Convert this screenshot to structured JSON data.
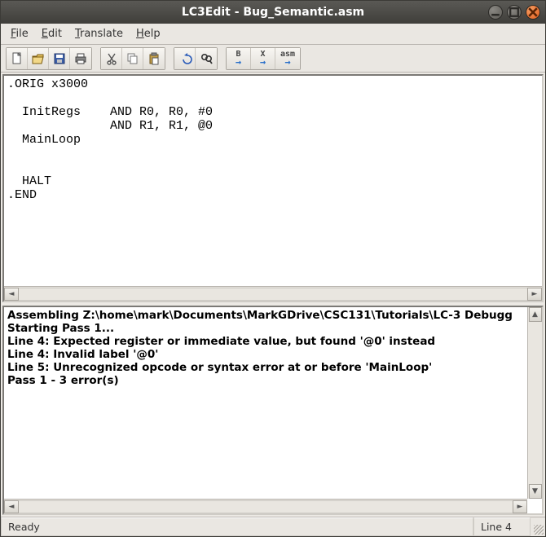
{
  "window": {
    "title": "LC3Edit - Bug_Semantic.asm"
  },
  "menu": {
    "file": "File",
    "edit": "Edit",
    "translate": "Translate",
    "help": "Help"
  },
  "toolbar": {
    "new": "new-icon",
    "open": "open-icon",
    "save": "save-icon",
    "print": "print-icon",
    "cut": "cut-icon",
    "copy": "copy-icon",
    "paste": "paste-icon",
    "undo": "undo-icon",
    "find": "find-icon",
    "asmB": "B",
    "asmX": "X",
    "asmA": "asm"
  },
  "editor": {
    "text": ".ORIG x3000\n\n  InitRegs    AND R0, R0, #0\n              AND R1, R1, @0\n  MainLoop\n\n\n  HALT\n.END"
  },
  "output": {
    "text": "Assembling Z:\\home\\mark\\Documents\\MarkGDrive\\CSC131\\Tutorials\\LC-3 Debugg\nStarting Pass 1...\nLine 4: Expected register or immediate value, but found '@0' instead\nLine 4: Invalid label '@0'\nLine 5: Unrecognized opcode or syntax error at or before 'MainLoop'\nPass 1 - 3 error(s)"
  },
  "status": {
    "left": "Ready",
    "right": "Line 4"
  }
}
